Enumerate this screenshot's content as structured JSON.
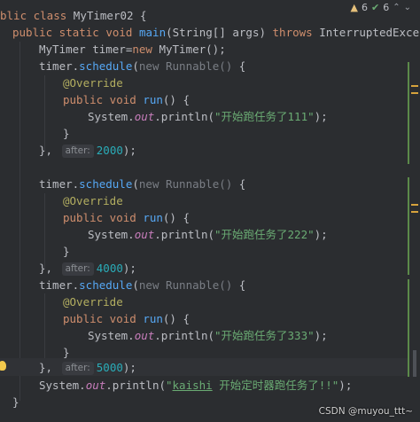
{
  "inspection": {
    "warnings": "6",
    "checks": "6"
  },
  "code": {
    "l1": {
      "kw": "blic class ",
      "name": "MyTimer02",
      "rest": " {"
    },
    "l2": {
      "kw1": "public static void ",
      "fn": "main",
      "args": "(String[] args) ",
      "kw2": "throws",
      "rest": " InterruptedException"
    },
    "l3": {
      "a": "MyTimer timer=",
      "kw": "new",
      "b": " MyTimer();"
    },
    "l4": {
      "a": "timer.",
      "fn": "schedule",
      "b": "(",
      "gray": "new Runnable()",
      "c": " {"
    },
    "ann": "@Override",
    "sig": {
      "kw": "public void ",
      "fn": "run",
      "rest": "() {"
    },
    "println1": {
      "a": "System.",
      "it": "out",
      "b": ".println(",
      "str": "\"开始跑任务了111\"",
      "c": ");"
    },
    "close_brace": "}",
    "end1": {
      "a": "}, ",
      "inlay": "after:",
      "num": "2000",
      "b": ");"
    },
    "println2": {
      "a": "System.",
      "it": "out",
      "b": ".println(",
      "str": "\"开始跑任务了222\"",
      "c": ");"
    },
    "end2": {
      "a": "}, ",
      "inlay": "after:",
      "num": "4000",
      "b": ");"
    },
    "println3": {
      "a": "System.",
      "it": "out",
      "b": ".println(",
      "str": "\"开始跑任务了333\"",
      "c": ");"
    },
    "end3": {
      "a": "}, ",
      "inlay": "after:",
      "num": "5000",
      "b": ");"
    },
    "final_println": {
      "a": "System.",
      "it": "out",
      "b": ".println(",
      "q1": "\"",
      "ul": "kaishi",
      "str": " 开始定时器跑任务了!!\"",
      "c": ");"
    },
    "method_close": "}"
  },
  "watermark": "CSDN @muyou_ttt~"
}
